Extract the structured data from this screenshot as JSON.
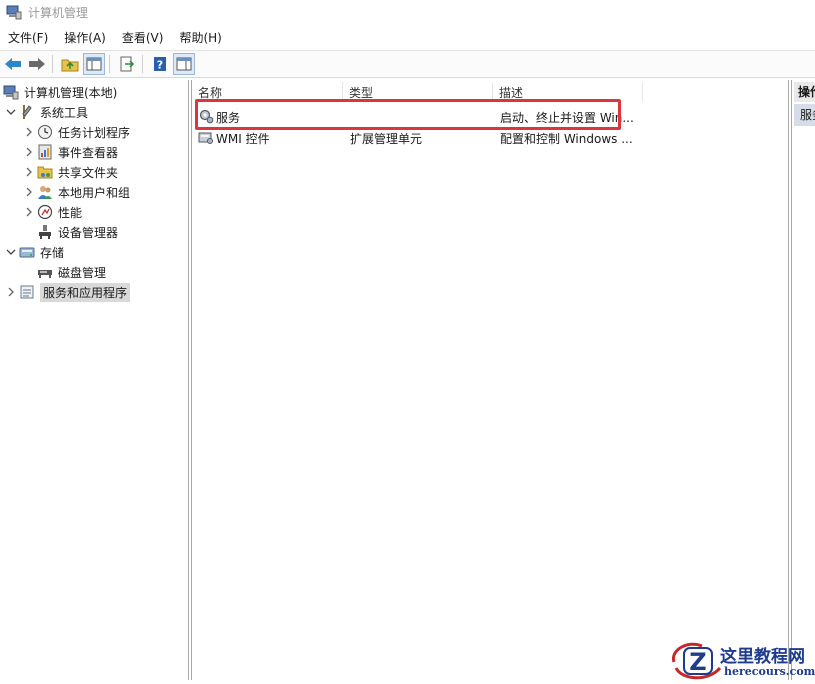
{
  "window": {
    "title": "计算机管理"
  },
  "menu": [
    "文件(F)",
    "操作(A)",
    "查看(V)",
    "帮助(H)"
  ],
  "tree": {
    "root": "计算机管理(本地)",
    "system_tools": "系统工具",
    "task_scheduler": "任务计划程序",
    "event_viewer": "事件查看器",
    "shared_folders": "共享文件夹",
    "local_users": "本地用户和组",
    "performance": "性能",
    "device_manager": "设备管理器",
    "storage": "存储",
    "disk_management": "磁盘管理",
    "services_apps": "服务和应用程序"
  },
  "list": {
    "columns": [
      "名称",
      "类型",
      "描述"
    ],
    "rows": [
      {
        "name": "服务",
        "type": "",
        "desc": "启动、终止并设置 Win..."
      },
      {
        "name": "WMI 控件",
        "type": "扩展管理单元",
        "desc": "配置和控制 Windows ..."
      }
    ]
  },
  "actions": {
    "header": "操作",
    "item": "服务"
  },
  "watermark": {
    "line1": "这里教程网",
    "line2": "herecours.com"
  },
  "colors": {
    "highlight": "#d9363e",
    "watermark": "#1e3b8c"
  }
}
